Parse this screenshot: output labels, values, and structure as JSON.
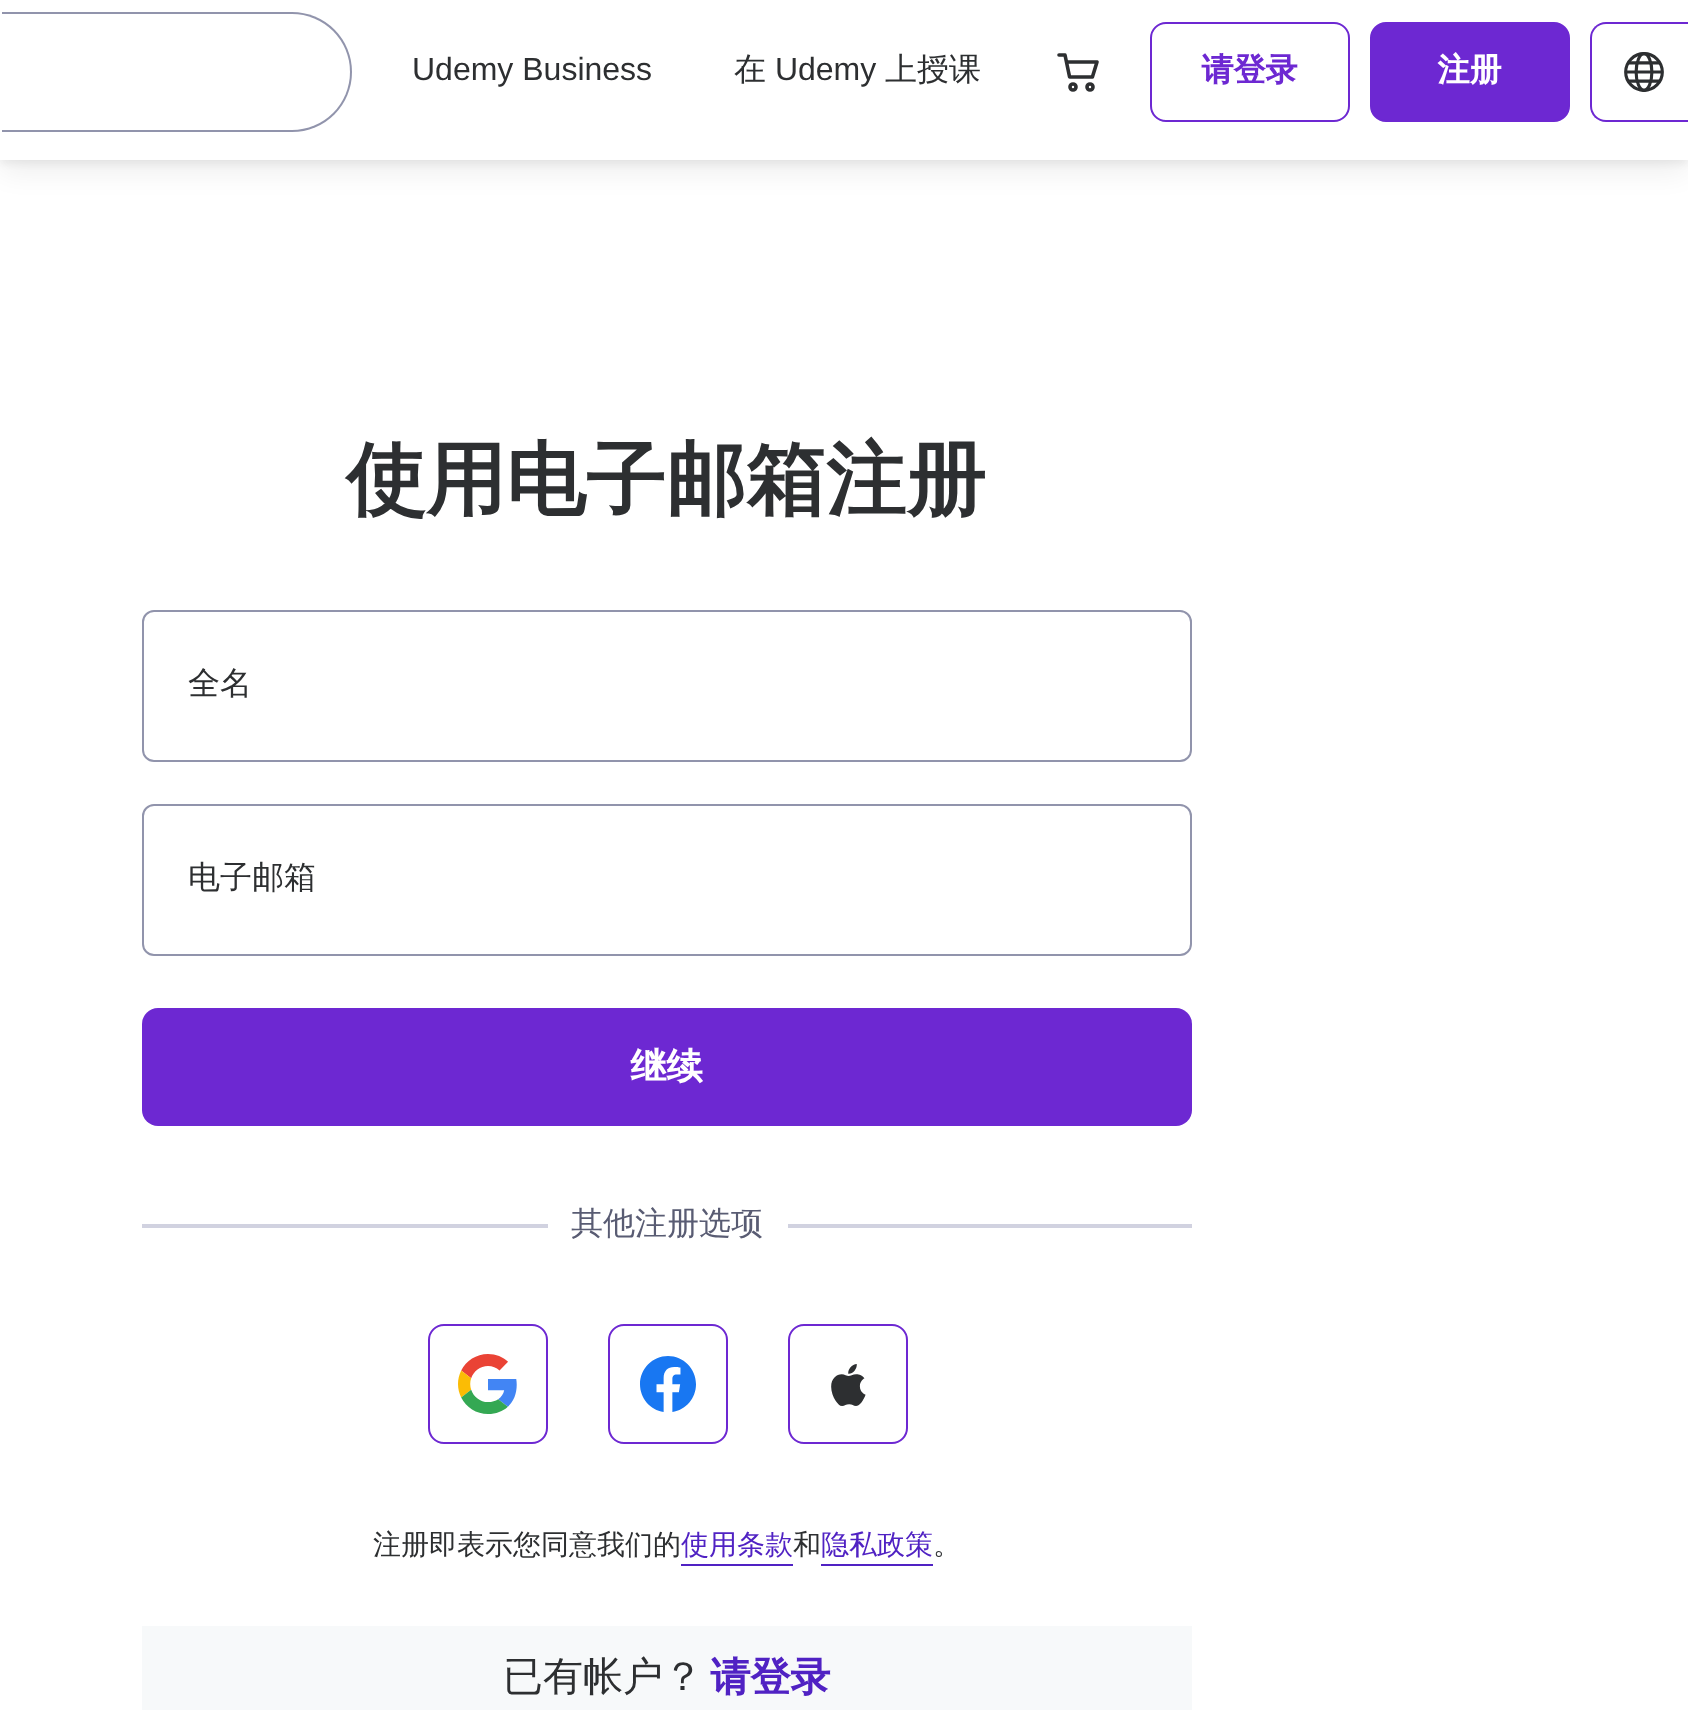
{
  "header": {
    "links": [
      "Udemy Business",
      "在 Udemy 上授课"
    ],
    "login_button": "请登录",
    "signup_button": "注册"
  },
  "form": {
    "title": "使用电子邮箱注册",
    "fields": [
      {
        "placeholder": "全名"
      },
      {
        "placeholder": "电子邮箱"
      }
    ],
    "submit_button": "继续",
    "divider_label": "其他注册选项",
    "social_buttons": [
      {
        "kind": "google"
      },
      {
        "kind": "facebook"
      },
      {
        "kind": "apple"
      }
    ],
    "terms": [
      {
        "kind": "text",
        "text": "注册即表示您同意我们的"
      },
      {
        "kind": "link",
        "text": "使用条款"
      },
      {
        "kind": "text",
        "text": "和"
      },
      {
        "kind": "link",
        "text": "隐私政策"
      },
      {
        "kind": "text",
        "text": "。"
      }
    ],
    "login_prompt": {
      "text": "已有帐户？",
      "link": "请登录"
    }
  }
}
